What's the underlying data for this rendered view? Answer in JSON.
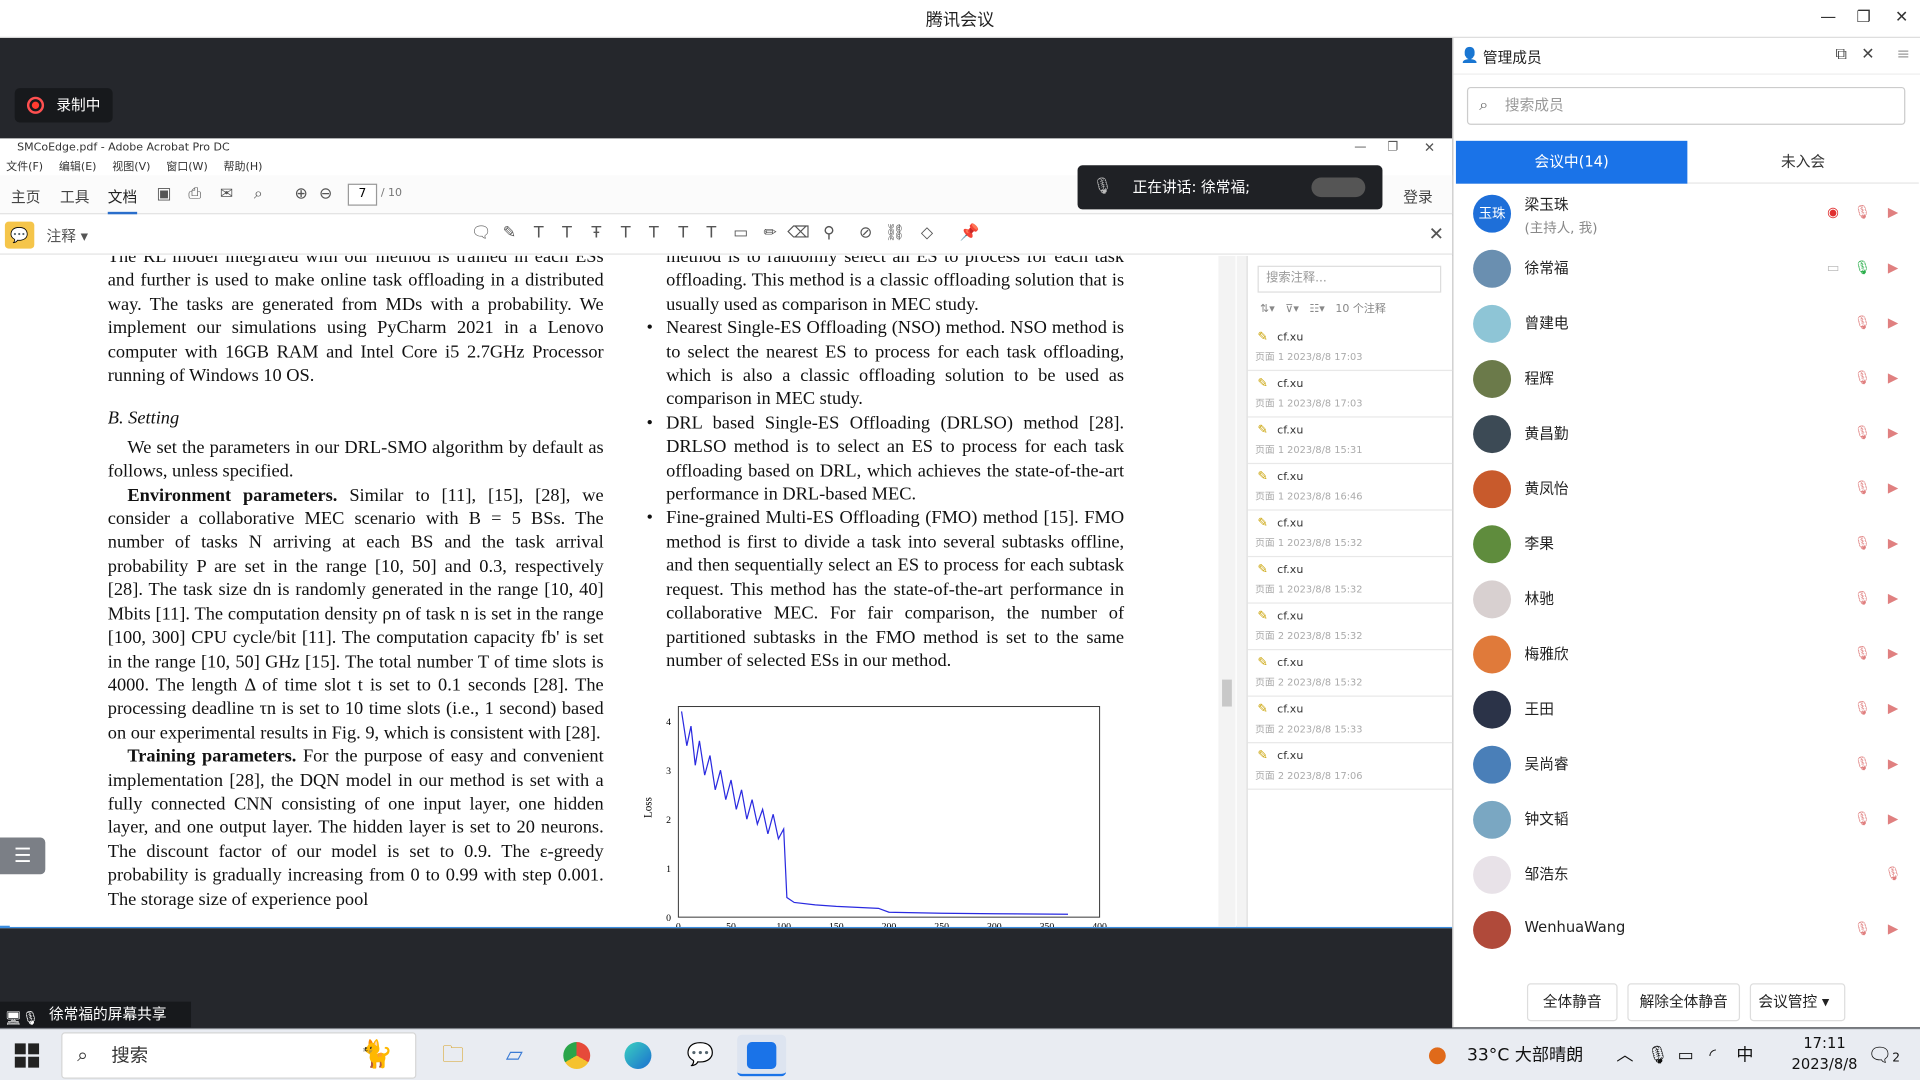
{
  "window": {
    "title": "腾讯会议"
  },
  "recording": {
    "label": "录制中"
  },
  "acrobat": {
    "title": "SMCoEdge.pdf - Adobe Acrobat Pro DC",
    "menus": [
      "文件(F)",
      "编辑(E)",
      "视图(V)",
      "窗口(W)",
      "帮助(H)"
    ],
    "tabs": [
      "主页",
      "工具",
      "文档"
    ],
    "page_current": "7",
    "page_total": "/ 10",
    "login": "登录",
    "annotate_label": "注释",
    "comments_search_placeholder": "搜索注释...",
    "comments_count": "10 个注释",
    "comments": [
      {
        "author": "cf.xu",
        "meta": "页面 1 2023/8/8 17:03"
      },
      {
        "author": "cf.xu",
        "meta": "页面 1 2023/8/8 17:03"
      },
      {
        "author": "cf.xu",
        "meta": "页面 1 2023/8/8 15:31"
      },
      {
        "author": "cf.xu",
        "meta": "页面 1 2023/8/8 16:46"
      },
      {
        "author": "cf.xu",
        "meta": "页面 1 2023/8/8 15:32"
      },
      {
        "author": "cf.xu",
        "meta": "页面 1 2023/8/8 15:32"
      },
      {
        "author": "cf.xu",
        "meta": "页面 2 2023/8/8 15:32"
      },
      {
        "author": "cf.xu",
        "meta": "页面 2 2023/8/8 15:32"
      },
      {
        "author": "cf.xu",
        "meta": "页面 2 2023/8/8 15:33"
      },
      {
        "author": "cf.xu",
        "meta": "页面 2 2023/8/8 17:06"
      }
    ]
  },
  "doc": {
    "left_top": "The RL model integrated with our method is trained in each ESs and further is used to make online task offloading in a distributed way. The tasks are generated from MDs with a probability. We implement our simulations using PyCharm 2021 in a Lenovo computer with 16GB RAM and Intel Core i5 2.7GHz Processor running of Windows 10 OS.",
    "heading": "B.  Setting",
    "p1": "We set the parameters in our DRL-SMO algorithm by default as follows, unless specified.",
    "env_label": "Environment parameters.",
    "env_text": "Similar to [11], [15], [28], we consider a collaborative MEC scenario with B = 5 BSs. The number of tasks N arriving at each BS and the task arrival probability P are set in the range [10, 50] and 0.3, respectively [28]. The task size dn is randomly generated in the range [10, 40] Mbits [11]. The computation density ρn of task n is set in the range [100, 300] CPU cycle/bit [11]. The computation capacity fb' is set in the range [10, 50] GHz [15]. The total number T of time slots is 4000. The length Δ of time slot t is set to 0.1 seconds [28]. The processing deadline τn is set to 10 time slots (i.e., 1 second) based on our experimental results in Fig. 9, which is consistent with [28].",
    "train_label": "Training parameters.",
    "train_text": "For the purpose of easy and convenient implementation [28], the DQN model in our method is set with a fully connected CNN consisting of one input layer, one hidden layer, and one output layer. The hidden layer is set to 20 neurons. The discount factor of our model is set to 0.9. The ε-greedy probability is gradually increasing from 0 to 0.99 with step 0.001. The storage size of experience pool",
    "right_top": "method is to randomly select an ES to process for each task offloading. This method is a classic offloading solution that is usually used as comparison in MEC study.",
    "b1": "Nearest Single-ES Offloading (NSO) method. NSO method is to select the nearest ES to process for each task offloading, which is also a classic offloading solution to be used as comparison in MEC study.",
    "b2": "DRL based Single-ES Offloading (DRLSO) method [28]. DRLSO method is to select an ES to process for each task offloading based on DRL, which achieves the state-of-the-art performance in DRL-based MEC.",
    "b3": "Fine-grained Multi-ES Offloading (FMO) method [15]. FMO method is first to divide a task into several subtasks offline, and then sequentially select an ES to process for each subtask request. This method has the state-of-the-art performance in collaborative MEC. For fair comparison, the number of partitioned subtasks in the FMO method is set to the same number of selected ESs in our method."
  },
  "chart_data": {
    "type": "line",
    "ylabel": "Loss",
    "yticks": [
      "0",
      "1",
      "2",
      "3",
      "4"
    ],
    "xticks": [
      "0",
      "50",
      "100",
      "150",
      "200",
      "250",
      "300",
      "350",
      "400"
    ],
    "ylim": [
      0,
      4.3
    ],
    "xlim": [
      0,
      400
    ],
    "series": [
      {
        "values": [
          [
            3,
            4.2
          ],
          [
            8,
            3.5
          ],
          [
            12,
            3.9
          ],
          [
            16,
            3.1
          ],
          [
            20,
            3.6
          ],
          [
            25,
            2.9
          ],
          [
            30,
            3.3
          ],
          [
            35,
            2.6
          ],
          [
            40,
            3.0
          ],
          [
            45,
            2.4
          ],
          [
            50,
            2.8
          ],
          [
            55,
            2.2
          ],
          [
            60,
            2.6
          ],
          [
            65,
            2.0
          ],
          [
            70,
            2.4
          ],
          [
            75,
            1.9
          ],
          [
            80,
            2.2
          ],
          [
            85,
            1.7
          ],
          [
            90,
            2.1
          ],
          [
            95,
            1.6
          ],
          [
            100,
            1.8
          ],
          [
            103,
            0.4
          ],
          [
            110,
            0.3
          ],
          [
            130,
            0.25
          ],
          [
            150,
            0.22
          ],
          [
            170,
            0.2
          ],
          [
            190,
            0.18
          ],
          [
            200,
            0.1
          ],
          [
            250,
            0.08
          ],
          [
            300,
            0.07
          ],
          [
            370,
            0.06
          ]
        ]
      }
    ]
  },
  "speaking": {
    "label": "正在讲话: 徐常福;"
  },
  "share": {
    "label": "徐常福的屏幕共享"
  },
  "members": {
    "title": "管理成员",
    "search_placeholder": "搜索成员",
    "tab_in": "会议中(14)",
    "tab_out": "未入会",
    "list": [
      {
        "name": "梁玉珠",
        "sub": "(主持人, 我)",
        "avatar_text": "玉珠",
        "color": "#1e6fd9"
      },
      {
        "name": "徐常福",
        "sub": "",
        "color": "#6a8fb0"
      },
      {
        "name": "曾建电",
        "sub": "",
        "color": "#8ec5d6"
      },
      {
        "name": "程辉",
        "sub": "",
        "color": "#6b7a4a"
      },
      {
        "name": "黄昌勤",
        "sub": "",
        "color": "#3c4a55"
      },
      {
        "name": "黄凤怡",
        "sub": "",
        "color": "#c85a2c"
      },
      {
        "name": "李果",
        "sub": "",
        "color": "#5f8c3d"
      },
      {
        "name": "林驰",
        "sub": "",
        "color": "#d8d0d0"
      },
      {
        "name": "梅雅欣",
        "sub": "",
        "color": "#e07a3a"
      },
      {
        "name": "王田",
        "sub": "",
        "color": "#2b3348"
      },
      {
        "name": "吴尚睿",
        "sub": "",
        "color": "#4a7fb8"
      },
      {
        "name": "钟文韬",
        "sub": "",
        "color": "#7aa7c2"
      },
      {
        "name": "邹浩东",
        "sub": "",
        "color": "#e8e2e8"
      },
      {
        "name": "WenhuaWang",
        "sub": "",
        "color": "#b04a3a"
      }
    ],
    "btn_mute_all": "全体静音",
    "btn_unmute_all": "解除全体静音",
    "btn_control": "会议管控"
  },
  "taskbar": {
    "search": "搜索",
    "weather": "33°C  大部晴朗",
    "ime": "中",
    "time": "17:11",
    "date": "2023/8/8",
    "notif": "2"
  }
}
